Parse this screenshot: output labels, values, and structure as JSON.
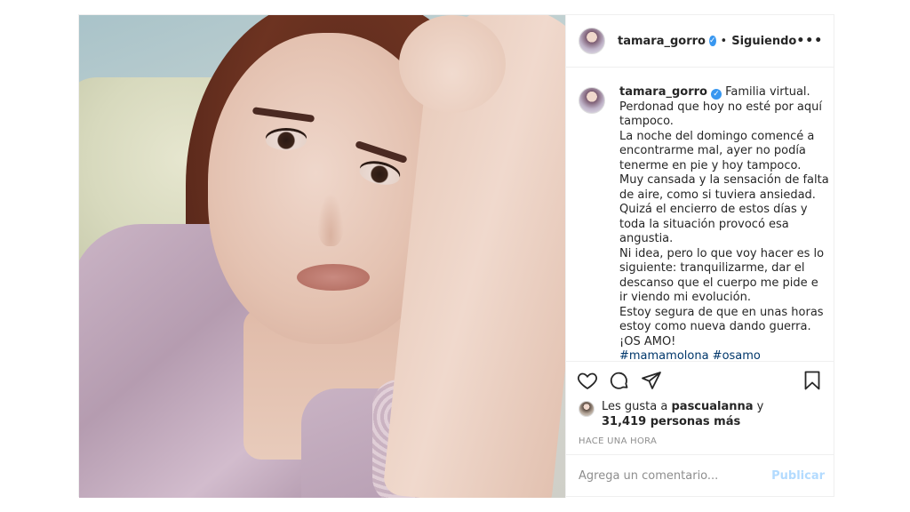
{
  "post": {
    "username": "tamara_gorro",
    "separator": "•",
    "follow_status": "Siguiendo",
    "more_label": "•••",
    "caption_lines": [
      "Perdonad que hoy no esté por aquí",
      "tampoco.",
      "La noche del domingo comencé a",
      "encontrarme mal, ayer no podía",
      "tenerme en pie y hoy tampoco.",
      "Muy cansada y la sensación de falta",
      "de aire, como si tuviera ansiedad.",
      "Quizá el encierro de estos días y",
      "toda la situación provocó esa",
      "angustia.",
      "Ni idea, pero lo que voy hacer es lo",
      "siguiente: tranquilizarme, dar el",
      "descanso que el cuerpo me pide e",
      "ir viendo mi evolución.",
      "Estoy segura de que en unas horas",
      "estoy como nueva dando guerra.",
      "¡OS AMO!"
    ],
    "caption_first": "Familia virtual.",
    "hashtags": "#mamamolona #osamo",
    "likes_prefix": "Les gusta a ",
    "likes_user": "pascualanna",
    "likes_mid": " y",
    "likes_count": "31,419 personas más",
    "time_ago": "HACE UNA HORA",
    "comment_placeholder": "Agrega un comentario...",
    "publish_label": "Publicar"
  },
  "icons": {
    "verified": "verified-badge-icon",
    "like": "heart-icon",
    "comment": "comment-bubble-icon",
    "share": "paper-plane-icon",
    "save": "bookmark-icon"
  },
  "colors": {
    "verified": "#3897f0",
    "publish_disabled": "#b3dbff",
    "hashtag": "#00376b",
    "muted": "#8e8e8e"
  }
}
